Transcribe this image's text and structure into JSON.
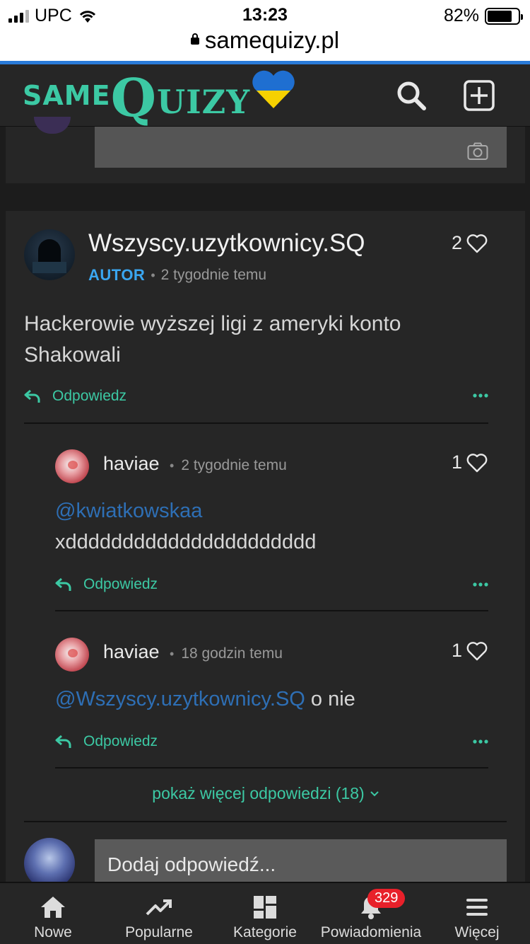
{
  "status_bar": {
    "carrier": "UPC",
    "time": "13:23",
    "battery": "82%",
    "battery_level": 0.82,
    "url": "samequizy.pl"
  },
  "header": {
    "logo_same": "SAME",
    "logo_quizy_first": "Q",
    "logo_quizy_rest": "UIZY",
    "search_icon": "search-icon",
    "add_icon": "plus-square-icon"
  },
  "colors": {
    "accent": "#3cc9a4",
    "author_badge": "#3aa6f0",
    "mention": "#2e6fb5",
    "notification": "#e8202a",
    "background": "#1c1c1c",
    "panel": "#262626"
  },
  "comment": {
    "author": "Wszyscy.uzytkownicy.SQ",
    "badge": "AUTOR",
    "time": "2 tygodnie temu",
    "likes": "2",
    "text": "Hackerowie wyższej ligi z ameryki konto Shakowali",
    "reply_label": "Odpowiedz"
  },
  "replies": [
    {
      "author": "haviae",
      "time": "2 tygodnie temu",
      "likes": "1",
      "mention": "@kwiatkowskaa",
      "text": "xdddddddddddddddddddddd",
      "reply_label": "Odpowiedz"
    },
    {
      "author": "haviae",
      "time": "18 godzin temu",
      "likes": "1",
      "mention": "@Wszyscy.uzytkownicy.SQ",
      "text": "o nie",
      "reply_label": "Odpowiedz"
    }
  ],
  "show_more": "pokaż więcej odpowiedzi (18)",
  "add_reply_placeholder": "Dodaj odpowiedź...",
  "bottom_nav": {
    "items": [
      {
        "label": "Nowe",
        "icon": "home-icon"
      },
      {
        "label": "Popularne",
        "icon": "trending-icon"
      },
      {
        "label": "Kategorie",
        "icon": "grid-icon"
      },
      {
        "label": "Powiadomienia",
        "icon": "bell-icon",
        "badge": "329"
      },
      {
        "label": "Więcej",
        "icon": "menu-icon"
      }
    ]
  }
}
